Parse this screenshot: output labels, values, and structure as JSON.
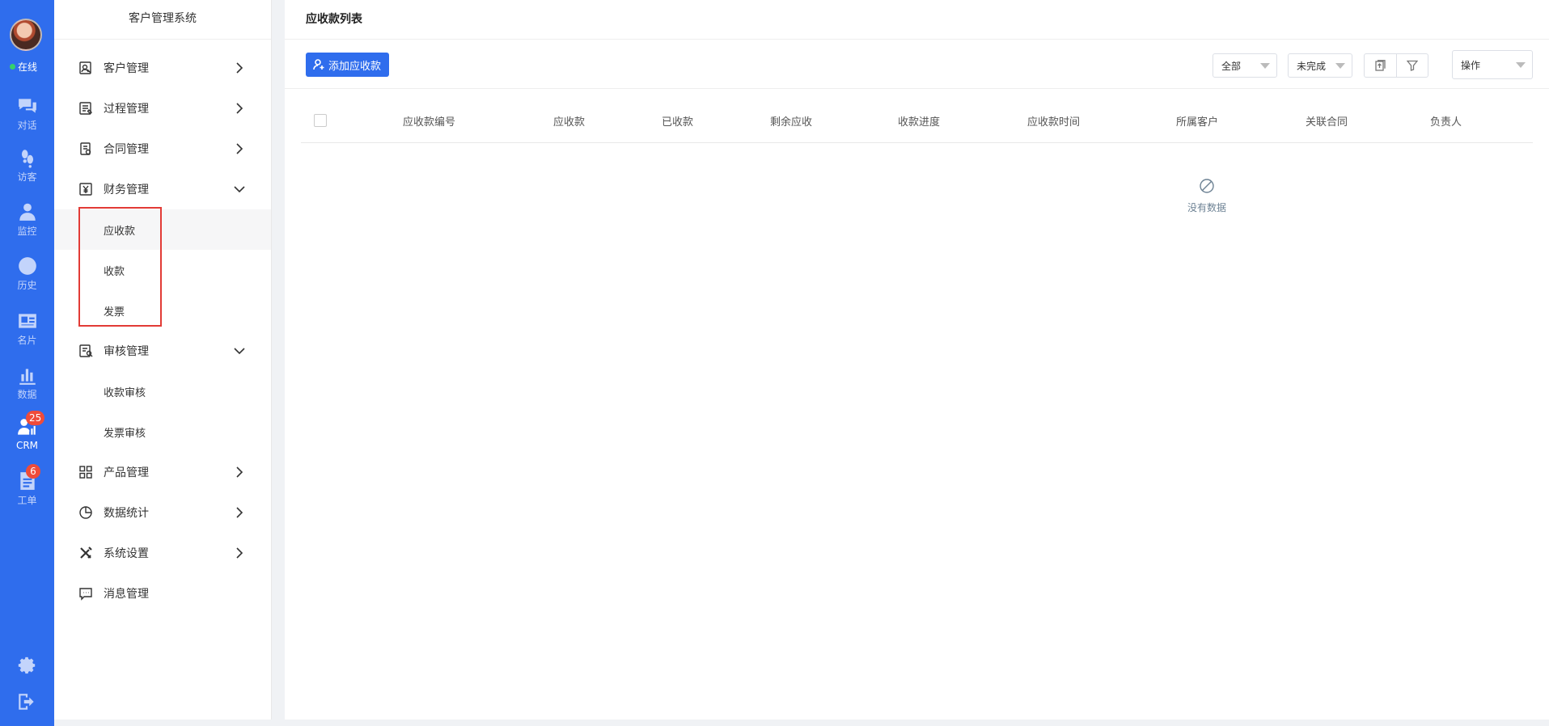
{
  "rail": {
    "status": "在线",
    "items": [
      {
        "label": "对话",
        "icon": "chat-icon"
      },
      {
        "label": "访客",
        "icon": "footprint-icon"
      },
      {
        "label": "监控",
        "icon": "monitor-user-icon"
      },
      {
        "label": "历史",
        "icon": "clock-icon"
      },
      {
        "label": "名片",
        "icon": "card-icon"
      },
      {
        "label": "数据",
        "icon": "bar-chart-icon"
      },
      {
        "label": "CRM",
        "icon": "crm-icon",
        "badge": "25"
      },
      {
        "label": "工单",
        "icon": "ticket-icon",
        "badge": "6"
      }
    ]
  },
  "sidebar": {
    "title": "客户管理系统",
    "menu": [
      {
        "label": "客户管理"
      },
      {
        "label": "过程管理"
      },
      {
        "label": "合同管理"
      },
      {
        "label": "财务管理",
        "sub": [
          "应收款",
          "收款",
          "发票"
        ]
      },
      {
        "label": "审核管理",
        "sub": [
          "收款审核",
          "发票审核"
        ]
      },
      {
        "label": "产品管理"
      },
      {
        "label": "数据统计"
      },
      {
        "label": "系统设置"
      },
      {
        "label": "消息管理"
      }
    ]
  },
  "main": {
    "title": "应收款列表",
    "add_button": "添加应收款",
    "filter_all": "全部",
    "filter_status": "未完成",
    "action_select": "操作",
    "columns": [
      "应收款编号",
      "应收款",
      "已收款",
      "剩余应收",
      "收款进度",
      "应收款时间",
      "所属客户",
      "关联合同",
      "负责人"
    ],
    "empty_text": "没有数据"
  },
  "colors": {
    "primary": "#2f6ded",
    "badge": "#ef4b3a",
    "highlight": "#e23b36"
  }
}
